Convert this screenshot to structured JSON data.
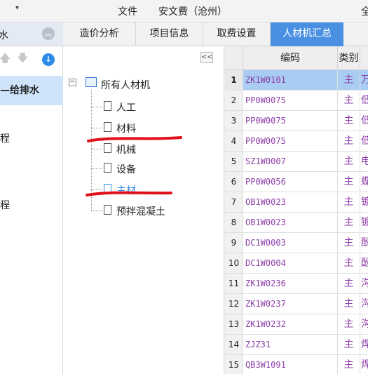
{
  "menubar": {
    "caret": "▾",
    "file_label": "文件",
    "project_label": "安文费（沧州）",
    "truncated": "全"
  },
  "sidebar": {
    "header": "水",
    "items": [
      {
        "label": "—给排水",
        "selected": true
      },
      {
        "label": "程",
        "selected": false
      },
      {
        "label": "程",
        "selected": false
      }
    ]
  },
  "tabs": [
    {
      "label": "造价分析",
      "active": false
    },
    {
      "label": "项目信息",
      "active": false
    },
    {
      "label": "取费设置",
      "active": false
    },
    {
      "label": "人材机汇总",
      "active": true
    }
  ],
  "tree": {
    "collapse_label": "<<",
    "root_label": "所有人材机",
    "nodes": [
      {
        "label": "人工",
        "highlight": false
      },
      {
        "label": "材料",
        "highlight": false
      },
      {
        "label": "机械",
        "highlight": false
      },
      {
        "label": "设备",
        "highlight": false
      },
      {
        "label": "主材",
        "highlight": true
      },
      {
        "label": "预拌混凝土",
        "highlight": false
      }
    ]
  },
  "grid": {
    "headers": {
      "code": "编码",
      "type": "类别"
    },
    "rows": [
      {
        "num": "1",
        "code": "ZK1W0101",
        "type": "主",
        "name": "万",
        "selected": true
      },
      {
        "num": "2",
        "code": "PP0W0075",
        "type": "主",
        "name": "低",
        "selected": false
      },
      {
        "num": "3",
        "code": "PP0W0075",
        "type": "主",
        "name": "低",
        "selected": false
      },
      {
        "num": "4",
        "code": "PP0W0075",
        "type": "主",
        "name": "低",
        "selected": false
      },
      {
        "num": "5",
        "code": "SZ1W0007",
        "type": "主",
        "name": "电",
        "selected": false
      },
      {
        "num": "6",
        "code": "PP0W0056",
        "type": "主",
        "name": "蝶",
        "selected": false
      },
      {
        "num": "7",
        "code": "OB1W0023",
        "type": "主",
        "name": "镀",
        "selected": false
      },
      {
        "num": "8",
        "code": "OB1W0023",
        "type": "主",
        "name": "镀",
        "selected": false
      },
      {
        "num": "9",
        "code": "DC1W0003",
        "type": "主",
        "name": "酚",
        "selected": false
      },
      {
        "num": "10",
        "code": "DC1W0004",
        "type": "主",
        "name": "酚",
        "selected": false
      },
      {
        "num": "11",
        "code": "ZK1W0236",
        "type": "主",
        "name": "沟",
        "selected": false
      },
      {
        "num": "12",
        "code": "ZK1W0237",
        "type": "主",
        "name": "沟",
        "selected": false
      },
      {
        "num": "13",
        "code": "ZK1W0232",
        "type": "主",
        "name": "沟",
        "selected": false
      },
      {
        "num": "14",
        "code": "ZJZ31",
        "type": "主",
        "name": "焊",
        "selected": false
      },
      {
        "num": "15",
        "code": "QB3W1091",
        "type": "主",
        "name": "焊",
        "selected": false
      }
    ]
  },
  "colors": {
    "accent": "#4a90e2",
    "selected_row": "#a9cdf2",
    "code_text": "#8e3fa8",
    "annotation": "#e0101a"
  },
  "icons": {
    "caret": "chevron-down-icon",
    "collapse": "collapse-up-icon",
    "up": "arrow-up-icon",
    "down": "arrow-down-icon",
    "download": "download-icon",
    "doc": "document-icon",
    "root": "folder-image-icon"
  }
}
